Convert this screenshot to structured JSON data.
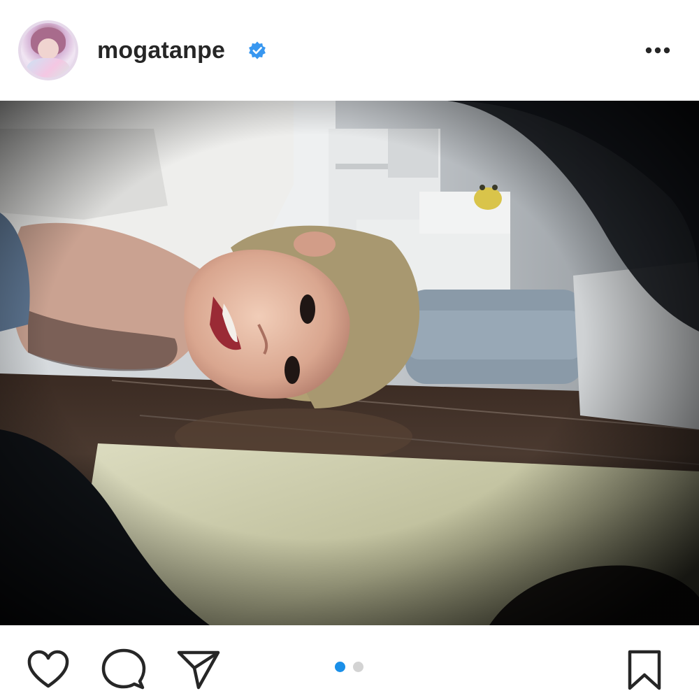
{
  "post": {
    "author": {
      "username": "mogatanpe",
      "verified": true,
      "avatar_icon": "profile-photo"
    },
    "header_menu_icon": "more-horizontal-icon",
    "media": {
      "type": "photo",
      "current_slide": 1,
      "total_slides": 2
    },
    "actions": {
      "like_icon": "heart-outline-icon",
      "comment_icon": "comment-bubble-icon",
      "share_icon": "paper-plane-icon",
      "save_icon": "bookmark-outline-icon"
    }
  },
  "colors": {
    "text": "#262626",
    "verified_blue": "#3897f0",
    "carousel_active": "#1a8fe8",
    "carousel_inactive": "#d3d3d3",
    "icon_stroke": "#262626"
  }
}
